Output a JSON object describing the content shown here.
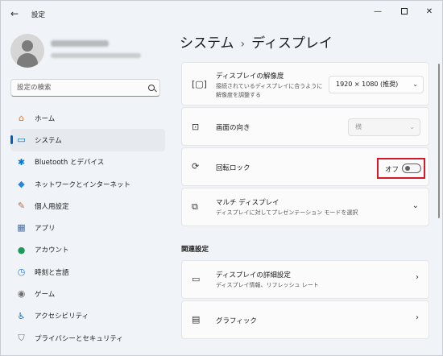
{
  "window": {
    "app_title": "設定",
    "back_glyph": "←",
    "min_glyph": "—",
    "close_glyph": "✕"
  },
  "sidebar": {
    "search_placeholder": "設定の検索",
    "items": [
      {
        "label": "ホーム",
        "icon": "home-icon",
        "glyph": "⌂",
        "color": "#d7782c"
      },
      {
        "label": "システム",
        "icon": "system-icon",
        "glyph": "▭",
        "color": "#0067c0",
        "active": true
      },
      {
        "label": "Bluetooth とデバイス",
        "icon": "bluetooth-icon",
        "glyph": "✱",
        "color": "#0078d4"
      },
      {
        "label": "ネットワークとインターネット",
        "icon": "network-icon",
        "glyph": "◆",
        "color": "#2b88d8"
      },
      {
        "label": "個人用設定",
        "icon": "personalization-icon",
        "glyph": "✎",
        "color": "#c5662f"
      },
      {
        "label": "アプリ",
        "icon": "apps-icon",
        "glyph": "▦",
        "color": "#4a6fa5"
      },
      {
        "label": "アカウント",
        "icon": "account-icon",
        "glyph": "●",
        "color": "#1c9a5c"
      },
      {
        "label": "時刻と言語",
        "icon": "time-language-icon",
        "glyph": "◷",
        "color": "#2d7bd2"
      },
      {
        "label": "ゲーム",
        "icon": "gaming-icon",
        "glyph": "◉",
        "color": "#6b6b6b"
      },
      {
        "label": "アクセシビリティ",
        "icon": "accessibility-icon",
        "glyph": "♿",
        "color": "#1f6fc2"
      },
      {
        "label": "プライバシーとセキュリティ",
        "icon": "privacy-icon",
        "glyph": "⛉",
        "color": "#6b6b6b"
      }
    ]
  },
  "main": {
    "breadcrumb_parent": "システム",
    "breadcrumb_sep": "›",
    "breadcrumb_current": "ディスプレイ",
    "resolution": {
      "title": "ディスプレイの解像度",
      "desc_line1": "接続されているディスプレイに合うように",
      "desc_line2": "解像度を調整する",
      "value": "1920 × 1080 (推奨)"
    },
    "orientation": {
      "title": "画面の向き",
      "value": "横"
    },
    "rotation_lock": {
      "title": "回転ロック",
      "state_label": "オフ"
    },
    "multi_display": {
      "title": "マルチ ディスプレイ",
      "desc": "ディスプレイに対してプレゼンテーション モードを選択"
    },
    "related_heading": "関連設定",
    "advanced_display": {
      "title": "ディスプレイの詳細設定",
      "desc": "ディスプレイ情報、リフレッシュ レート"
    },
    "graphics": {
      "title": "グラフィック"
    },
    "dropdown_glyph": "⌄",
    "chevron_glyph": "›",
    "expand_glyph": "⌄"
  },
  "colors": {
    "accent": "#005fb8",
    "highlight_border": "#d7182a"
  }
}
